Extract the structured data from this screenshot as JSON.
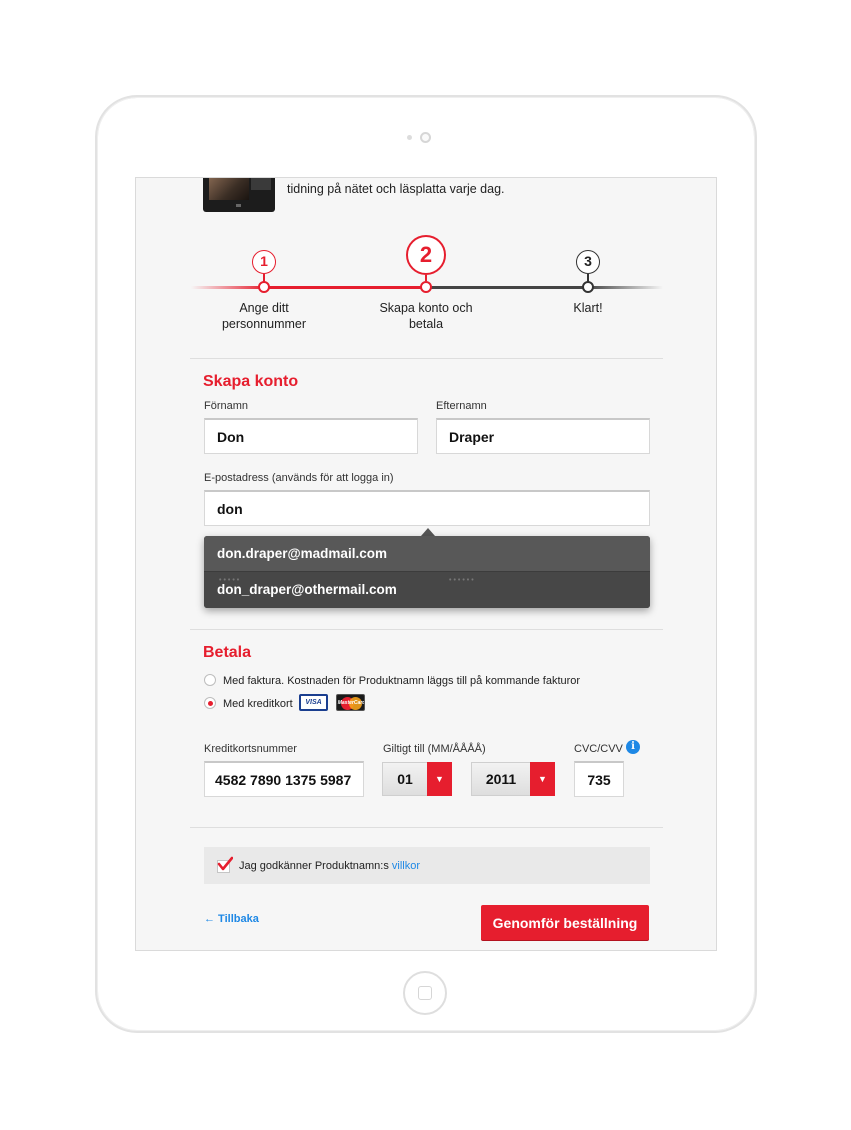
{
  "promo": {
    "text": "tidning på nätet och läsplatta varje dag."
  },
  "steps": [
    {
      "number": "1",
      "label": "Ange ditt personnummer"
    },
    {
      "number": "2",
      "label": "Skapa konto och betala"
    },
    {
      "number": "3",
      "label": "Klart!"
    }
  ],
  "account": {
    "title": "Skapa konto",
    "first_name_label": "Förnamn",
    "first_name_value": "Don",
    "last_name_label": "Efternamn",
    "last_name_value": "Draper",
    "email_label": "E-postadress (används för att logga in)",
    "email_value": "don",
    "suggestions": [
      "don.draper@madmail.com",
      "don_draper@othermail.com"
    ]
  },
  "payment": {
    "title": "Betala",
    "invoice_label": "Med faktura. Kostnaden för Produktnamn läggs till på kommande fakturor",
    "card_label": "Med kreditkort",
    "selected_method": "card",
    "card_logos": [
      "VISA",
      "MasterCard"
    ],
    "card_number_label": "Kreditkortsnummer",
    "card_number_value": "4582 7890 1375 5987",
    "expiry_label": "Giltigt till (MM/ÅÅÅÅ)",
    "expiry_month": "01",
    "expiry_year": "2011",
    "cvc_label": "CVC/CVV",
    "cvc_value": "735",
    "info_icon": "i"
  },
  "terms": {
    "text": "Jag godkänner Produktnamn:s",
    "link": "villkor",
    "checked": true
  },
  "actions": {
    "back_label": "← Tillbaka",
    "submit_label": "Genomför beställning"
  },
  "colors": {
    "accent": "#e61e2e",
    "link": "#1e88e5",
    "dropdown_bg": "#4a4a4a"
  }
}
